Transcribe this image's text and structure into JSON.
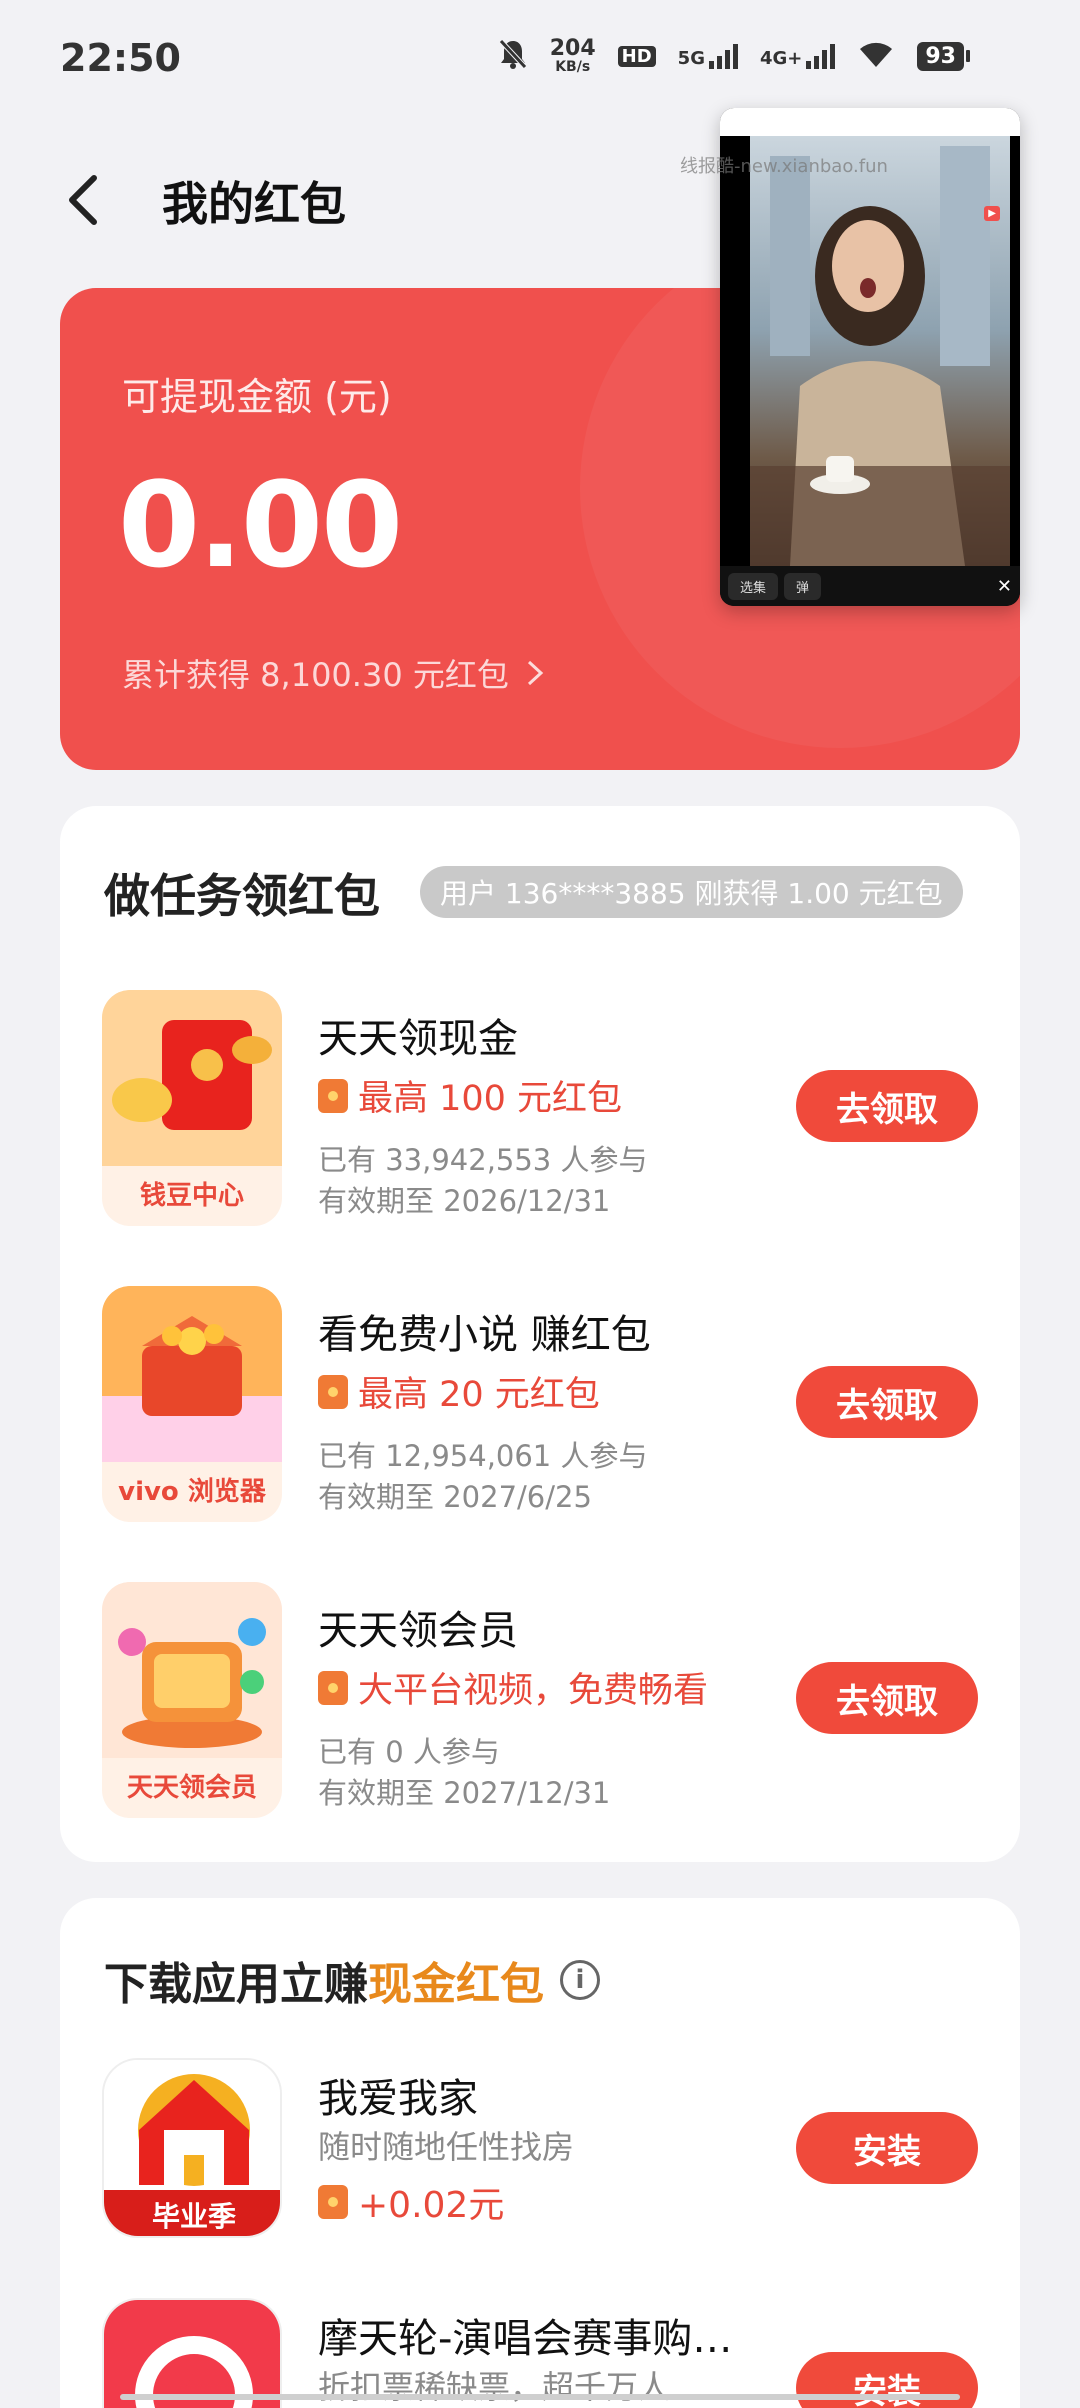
{
  "status_bar": {
    "time": "22:50",
    "net_speed_value": "204",
    "net_speed_unit": "KB/s",
    "hd_label": "HD",
    "net_5g": "5G",
    "net_4g": "4G+",
    "battery": "93"
  },
  "header": {
    "title": "我的红包"
  },
  "balance": {
    "label": "可提现金额 (元)",
    "amount": "0.00",
    "total_text": "累计获得 8,100.30 元红包"
  },
  "video_overlay": {
    "watermark": "线报酷-new.xianbao.fun",
    "collection_label": "选集",
    "danmaku_label": "弹"
  },
  "tasks": {
    "title": "做任务领红包",
    "ticker": "用户 136****3885 刚获得 1.00 元红包",
    "items": [
      {
        "app_name": "钱豆中心",
        "title": "天天领现金",
        "reward": "最高 100 元红包",
        "participants": "已有 33,942,553 人参与",
        "validity": "有效期至 2026/12/31",
        "button": "去领取"
      },
      {
        "app_name": "vivo 浏览器",
        "title": "看免费小说 赚红包",
        "reward": "最高 20 元红包",
        "participants": "已有 12,954,061 人参与",
        "validity": "有效期至 2027/6/25",
        "button": "去领取"
      },
      {
        "app_name": "天天领会员",
        "title": "天天领会员",
        "reward": "大平台视频，免费畅看",
        "participants": "已有 0 人参与",
        "validity": "有效期至 2027/12/31",
        "button": "去领取"
      }
    ]
  },
  "downloads": {
    "title_prefix": "下载应用立赚",
    "title_highlight": "现金红包",
    "items": [
      {
        "icon_label": "毕业季",
        "name": "我爱我家",
        "desc": "随时随地任性找房",
        "reward": "+0.02元",
        "button": "安装"
      },
      {
        "name": "摩天轮-演唱会赛事购…",
        "desc": "折扣票稀缺票，超千万人…",
        "button": "安装"
      }
    ]
  }
}
